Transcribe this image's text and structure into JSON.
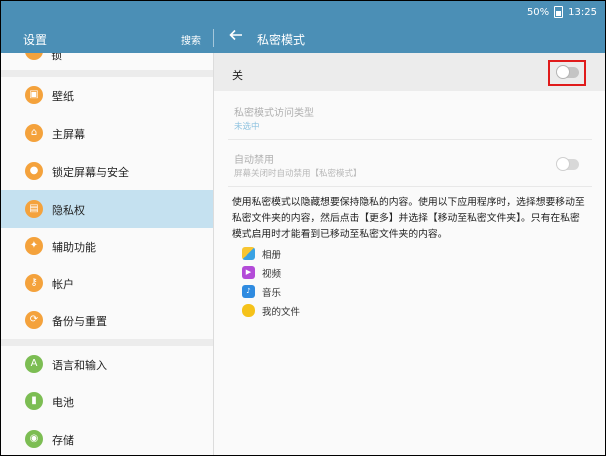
{
  "status": {
    "battery": "50%",
    "time": "13:25"
  },
  "appbar": {
    "title": "设置",
    "search": "搜索",
    "page_title": "私密模式"
  },
  "sidebar": {
    "peek_label": "锁",
    "items": [
      {
        "label": "壁纸",
        "icon": "wallpaper-icon"
      },
      {
        "label": "主屏幕",
        "icon": "home-icon"
      },
      {
        "label": "锁定屏幕与安全",
        "icon": "lock-icon"
      },
      {
        "label": "隐私权",
        "icon": "privacy-icon",
        "active": true
      },
      {
        "label": "辅助功能",
        "icon": "accessibility-icon"
      },
      {
        "label": "帐户",
        "icon": "key-icon"
      },
      {
        "label": "备份与重置",
        "icon": "backup-icon"
      },
      {
        "label": "语言和输入",
        "icon": "language-icon"
      },
      {
        "label": "电池",
        "icon": "battery-icon"
      },
      {
        "label": "存储",
        "icon": "storage-icon"
      }
    ]
  },
  "private_mode": {
    "master_label": "关",
    "master_on": false,
    "access_type_title": "私密模式访问类型",
    "access_type_value": "未选中",
    "auto_disable_title": "自动禁用",
    "auto_disable_sub": "屏幕关闭时自动禁用【私密模式】",
    "auto_disable_on": false,
    "description": "使用私密模式以隐藏想要保持隐私的内容。使用以下应用程序时，选择想要移动至私密文件夹的内容，然后点击【更多】并选择【移动至私密文件夹】。只有在私密模式启用时才能看到已移动至私密文件夹的内容。",
    "apps": [
      {
        "label": "相册",
        "icon": "gallery-icon"
      },
      {
        "label": "视频",
        "icon": "video-icon"
      },
      {
        "label": "音乐",
        "icon": "music-icon"
      },
      {
        "label": "我的文件",
        "icon": "my-files-icon"
      }
    ]
  },
  "colors": {
    "header": "#4b8fb6",
    "active_item": "#c5e1f0",
    "icon_orange": "#f4a23c",
    "icon_green": "#7cbd53",
    "highlight": "#e01b1b",
    "link_blue": "#8fc3e0"
  }
}
